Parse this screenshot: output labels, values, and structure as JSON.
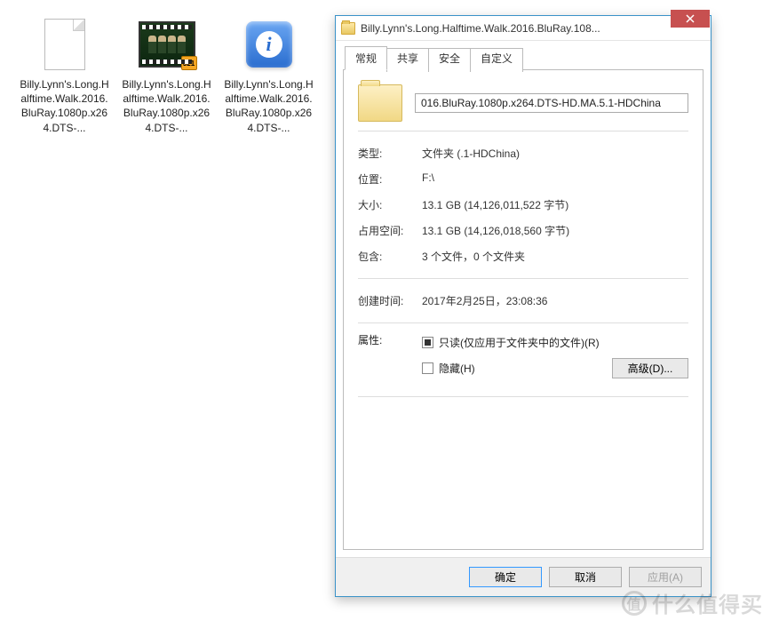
{
  "files": [
    {
      "label": "Billy.Lynn's.Long.Halftime.Walk.2016.BluRay.1080p.x264.DTS-...",
      "kind": "doc"
    },
    {
      "label": "Billy.Lynn's.Long.Halftime.Walk.2016.BluRay.1080p.x264.DTS-...",
      "kind": "video",
      "badge": "321"
    },
    {
      "label": "Billy.Lynn's.Long.Halftime.Walk.2016.BluRay.1080p.x264.DTS-...",
      "kind": "info"
    }
  ],
  "dialog": {
    "title": "Billy.Lynn's.Long.Halftime.Walk.2016.BluRay.108...",
    "tabs": [
      "常规",
      "共享",
      "安全",
      "自定义"
    ],
    "folder_name": "016.BluRay.1080p.x264.DTS-HD.MA.5.1-HDChina",
    "rows": {
      "type_label": "类型:",
      "type_value": "文件夹 (.1-HDChina)",
      "location_label": "位置:",
      "location_value": "F:\\",
      "size_label": "大小:",
      "size_value": "13.1 GB (14,126,011,522 字节)",
      "ondisk_label": "占用空间:",
      "ondisk_value": "13.1 GB (14,126,018,560 字节)",
      "contains_label": "包含:",
      "contains_value": "3 个文件，0 个文件夹",
      "created_label": "创建时间:",
      "created_value": "2017年2月25日，23:08:36",
      "attr_label": "属性:",
      "readonly_label": "只读(仅应用于文件夹中的文件)(R)",
      "hidden_label": "隐藏(H)",
      "advanced_label": "高级(D)..."
    },
    "buttons": {
      "ok": "确定",
      "cancel": "取消",
      "apply": "应用(A)"
    }
  },
  "info_glyph": "i",
  "watermark": "值 什么值得买"
}
